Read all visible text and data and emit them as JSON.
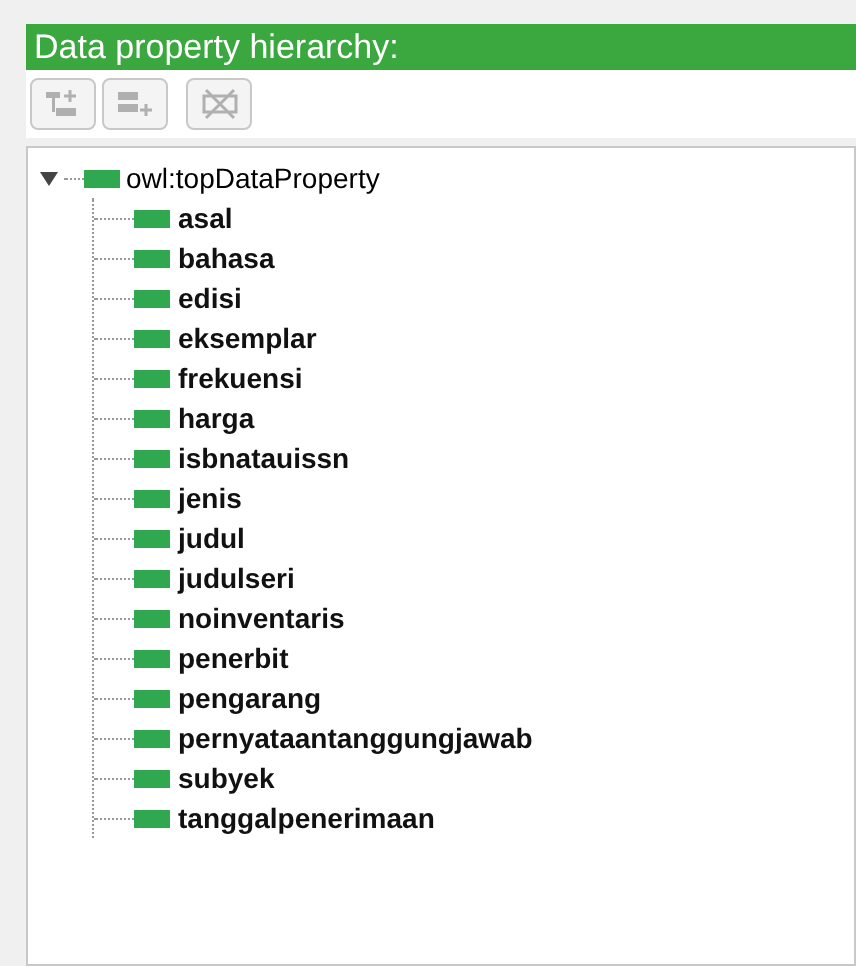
{
  "panel": {
    "title": "Data property hierarchy:"
  },
  "toolbar": [
    {
      "kind": "add-sub",
      "disabled": true
    },
    {
      "kind": "add-sibling",
      "disabled": true
    },
    {
      "kind": "delete",
      "disabled": true
    }
  ],
  "tree": {
    "label": "owl:topDataProperty",
    "expanded": true,
    "children": [
      {
        "label": "asal"
      },
      {
        "label": "bahasa"
      },
      {
        "label": "edisi"
      },
      {
        "label": "eksemplar"
      },
      {
        "label": "frekuensi"
      },
      {
        "label": "harga"
      },
      {
        "label": "isbnatauissn"
      },
      {
        "label": "jenis"
      },
      {
        "label": "judul"
      },
      {
        "label": "judulseri"
      },
      {
        "label": "noinventaris"
      },
      {
        "label": "penerbit"
      },
      {
        "label": "pengarang"
      },
      {
        "label": "pernyataantanggungjawab"
      },
      {
        "label": "subyek"
      },
      {
        "label": "tanggalpenerimaan"
      }
    ]
  }
}
